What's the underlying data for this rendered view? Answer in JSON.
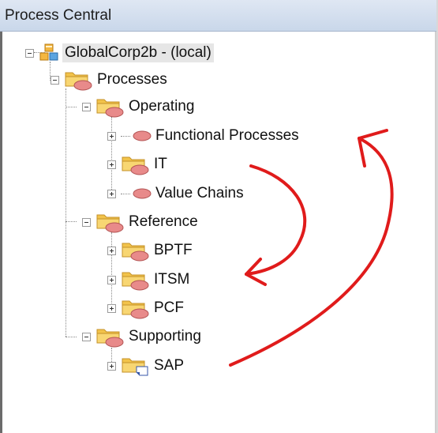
{
  "window": {
    "title": "Process Central"
  },
  "tree": {
    "root": {
      "label": "GlobalCorp2b - (local)"
    },
    "processes": {
      "label": "Processes"
    },
    "operating": {
      "label": "Operating"
    },
    "functional_processes": {
      "label": "Functional Processes"
    },
    "it": {
      "label": "IT"
    },
    "value_chains": {
      "label": "Value Chains"
    },
    "reference": {
      "label": "Reference"
    },
    "bptf": {
      "label": "BPTF"
    },
    "itsm": {
      "label": "ITSM"
    },
    "pcf": {
      "label": "PCF"
    },
    "supporting": {
      "label": "Supporting"
    },
    "sap": {
      "label": "SAP"
    }
  },
  "icons": {
    "root": "server-group-icon",
    "folder": "folder-process-icon",
    "process": "process-ellipse-icon",
    "folder_doc": "folder-document-icon"
  },
  "colors": {
    "folder": "#f2c34a",
    "process": "#e88a8a",
    "annotation": "#e01b1b"
  }
}
